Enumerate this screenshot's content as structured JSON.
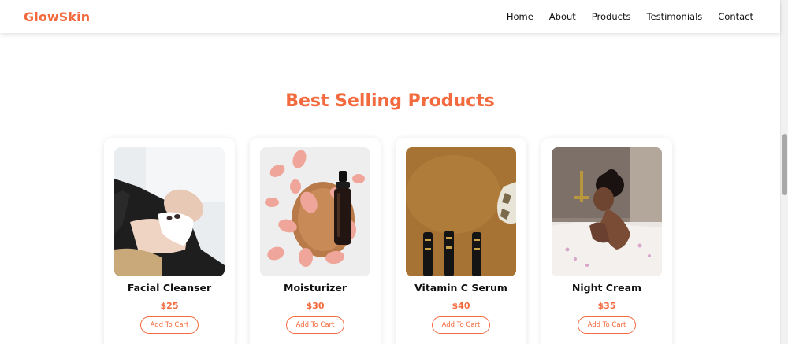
{
  "colors": {
    "accent": "#f26a3d",
    "text": "#111111",
    "background": "#ffffff"
  },
  "nav": {
    "brand": "GlowSkin",
    "links": [
      "Home",
      "About",
      "Products",
      "Testimonials",
      "Contact"
    ]
  },
  "section": {
    "title": "Best Selling Products"
  },
  "products": [
    {
      "name": "Facial Cleanser",
      "price": "$25",
      "button": "Add To Cart",
      "image": "woman-facial-cleansing-photo"
    },
    {
      "name": "Moisturizer",
      "price": "$30",
      "button": "Add To Cart",
      "image": "serum-bottle-rose-petals-photo"
    },
    {
      "name": "Vitamin C Serum",
      "price": "$40",
      "button": "Add To Cart",
      "image": "serum-droppers-photo"
    },
    {
      "name": "Night Cream",
      "price": "$35",
      "button": "Add To Cart",
      "image": "woman-bathtub-photo"
    }
  ]
}
